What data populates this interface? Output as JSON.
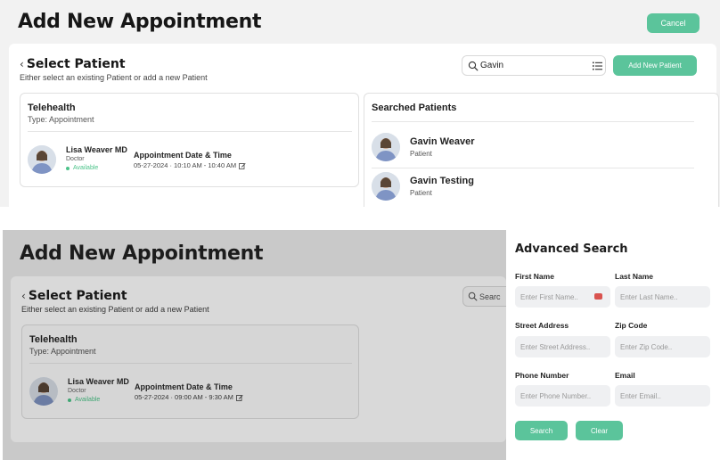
{
  "top": {
    "page_title": "Add New Appointment",
    "cancel_label": "Cancel",
    "section_title": "Select Patient",
    "section_subtitle": "Either select an existing Patient or add a new Patient",
    "search": {
      "value": "Gavin",
      "placeholder": "Search"
    },
    "add_new_patient_label": "Add New Patient",
    "appointment": {
      "title": "Telehealth",
      "type": "Type: Appointment",
      "doctor_name": "Lisa Weaver MD",
      "doctor_role": "Doctor",
      "doctor_status": "Available",
      "datetime_label": "Appointment Date & Time",
      "datetime_value": "05-27-2024 · 10:10 AM - 10:40 AM"
    },
    "searched": {
      "title": "Searched Patients",
      "patients": [
        {
          "name": "Gavin Weaver",
          "role": "Patient"
        },
        {
          "name": "Gavin Testing",
          "role": "Patient"
        }
      ]
    }
  },
  "bottom": {
    "page_title": "Add New Appointment",
    "section_title": "Select Patient",
    "section_subtitle": "Either select an existing Patient or add a new Patient",
    "search_partial": "Searc",
    "appointment": {
      "title": "Telehealth",
      "type": "Type: Appointment",
      "doctor_name": "Lisa Weaver MD",
      "doctor_role": "Doctor",
      "doctor_status": "Available",
      "datetime_label": "Appointment Date & Time",
      "datetime_value": "05-27-2024 · 09:00 AM - 9:30 AM"
    },
    "advanced": {
      "title": "Advanced Search",
      "first_name_label": "First Name",
      "first_name_placeholder": "Enter First Name..",
      "last_name_label": "Last Name",
      "last_name_placeholder": "Enter Last Name..",
      "street_label": "Street Address",
      "street_placeholder": "Enter Street Address..",
      "zip_label": "Zip Code",
      "zip_placeholder": "Enter Zip Code..",
      "phone_label": "Phone Number",
      "phone_placeholder": "Enter Phone Number..",
      "email_label": "Email",
      "email_placeholder": "Enter Email..",
      "search_label": "Search",
      "clear_label": "Clear"
    }
  },
  "colors": {
    "accent": "#5bc49b",
    "status_green": "#4cc38a",
    "panel_bg": "#f2f2f2",
    "dim_bg": "#c9c9c9"
  },
  "icons": [
    "chevron-left-icon",
    "search-icon",
    "list-icon",
    "edit-icon",
    "password-manager-icon",
    "status-dot-icon"
  ]
}
